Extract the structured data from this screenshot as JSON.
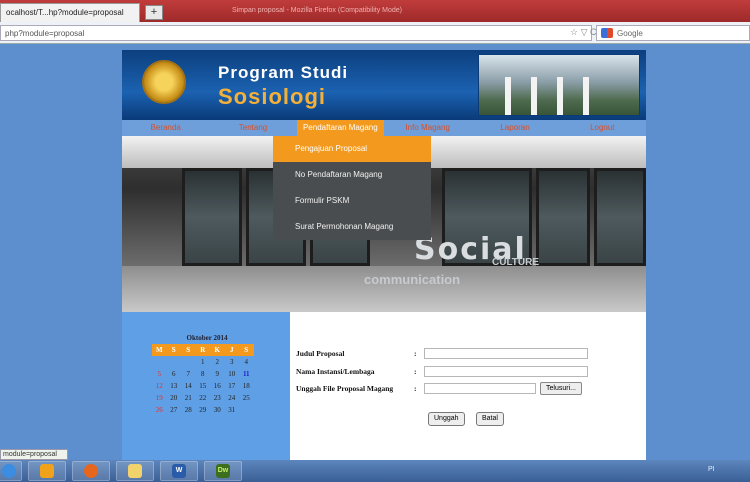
{
  "browser": {
    "tab_title": "ocalhost/T...hp?module=proposal",
    "new_tab": "+",
    "window_title": "Simpan proposal - Mozilla Firefox (Compatibility Mode)",
    "address": "php?module=proposal",
    "search_engine": "Google",
    "nav_icons": "☆ ▽ C"
  },
  "header": {
    "line1": "Program Studi",
    "line2": "Sosiologi"
  },
  "nav": {
    "items": [
      "Beranda",
      "Tentang",
      "Pendaftaran Magang",
      "Info Magang",
      "Laporan",
      "Logout"
    ],
    "active_index": 2
  },
  "dropdown": {
    "items": [
      "Pengajuan Proposal",
      "No Pendaftaran Magang",
      "Formulir PSKM",
      "Surat Permohonan Magang"
    ],
    "active_index": 0
  },
  "hero": {
    "text1": "Social",
    "text2": "CULTURE",
    "text3": "communication"
  },
  "calendar": {
    "title": "Oktober 2014",
    "days": [
      "M",
      "S",
      "S",
      "R",
      "K",
      "J",
      "S"
    ],
    "weeks": [
      [
        "",
        "",
        "",
        "1",
        "2",
        "3",
        "4"
      ],
      [
        "5",
        "6",
        "7",
        "8",
        "9",
        "10",
        "11"
      ],
      [
        "12",
        "13",
        "14",
        "15",
        "16",
        "17",
        "18"
      ],
      [
        "19",
        "20",
        "21",
        "22",
        "23",
        "24",
        "25"
      ],
      [
        "26",
        "27",
        "28",
        "29",
        "30",
        "31",
        ""
      ]
    ],
    "today": "11"
  },
  "form": {
    "title_label": "Judul Proposal",
    "institution_label": "Nama Instansi/Lembaga",
    "file_label": "Unggah File Proposal Magang",
    "colon": ":",
    "browse_label": "Telusuri...",
    "upload_label": "Unggah",
    "cancel_label": "Batal"
  },
  "status": {
    "url": "module=proposal"
  },
  "taskbar": {
    "apps": [
      "ie",
      "firefox",
      "explorer",
      "word",
      "dreamweaver"
    ],
    "dw_label": "Dw",
    "word_label": "W",
    "tray": "PI"
  }
}
